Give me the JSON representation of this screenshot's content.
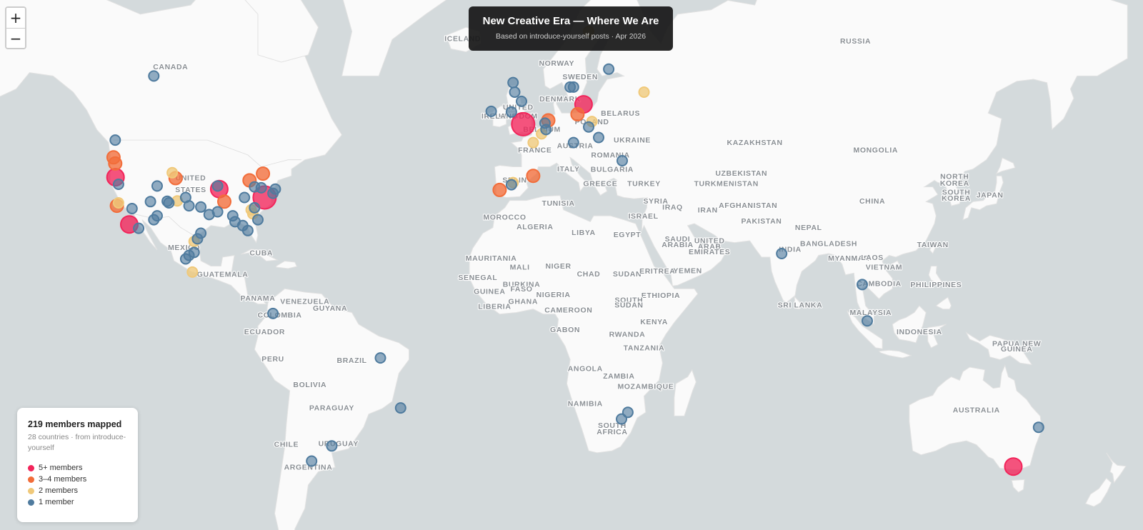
{
  "title": "New Creative Era — Where We Are",
  "subtitle": "Based on introduce-yourself posts · Apr 2026",
  "zoom": {
    "in_label": "+",
    "out_label": "−"
  },
  "legend": {
    "heading": "219 members mapped",
    "subtitle": "28 countries · from introduce-yourself",
    "items": [
      {
        "label": "5+ members",
        "color": "#f2245a"
      },
      {
        "label": "3–4 members",
        "color": "#f26d3a"
      },
      {
        "label": "2 members",
        "color": "#f0c97a"
      },
      {
        "label": "1 member",
        "color": "#4f7b9e"
      }
    ]
  },
  "colors": {
    "water": "#d4dadc",
    "land": "#fafafa"
  },
  "country_labels": [
    {
      "name": "CANADA",
      "lon": -106,
      "lat": 61
    },
    {
      "name": "UNITED",
      "lon": -100,
      "lat": 40.5
    },
    {
      "name": "STATES",
      "lon": -100,
      "lat": 37.8
    },
    {
      "name": "MEXICO",
      "lon": -102,
      "lat": 23
    },
    {
      "name": "CUBA",
      "lon": -79,
      "lat": 21.5
    },
    {
      "name": "GUATEMALA",
      "lon": -90.5,
      "lat": 15.4
    },
    {
      "name": "PANAMA",
      "lon": -80,
      "lat": 8.5
    },
    {
      "name": "VENEZUELA",
      "lon": -66,
      "lat": 7.5
    },
    {
      "name": "COLOMBIA",
      "lon": -73.5,
      "lat": 3.5
    },
    {
      "name": "GUYANA",
      "lon": -58.5,
      "lat": 5.5
    },
    {
      "name": "ECUADOR",
      "lon": -78,
      "lat": -1.5
    },
    {
      "name": "PERU",
      "lon": -75.5,
      "lat": -9.5
    },
    {
      "name": "BRAZIL",
      "lon": -52,
      "lat": -10
    },
    {
      "name": "BOLIVIA",
      "lon": -64.5,
      "lat": -17
    },
    {
      "name": "PARAGUAY",
      "lon": -58,
      "lat": -23.5
    },
    {
      "name": "CHILE",
      "lon": -71.5,
      "lat": -33
    },
    {
      "name": "ARGENTINA",
      "lon": -65,
      "lat": -38.5
    },
    {
      "name": "URUGUAY",
      "lon": -56,
      "lat": -32.8
    },
    {
      "name": "ICELAND",
      "lon": -19,
      "lat": 64.8
    },
    {
      "name": "NORWAY",
      "lon": 9,
      "lat": 61.5
    },
    {
      "name": "SWEDEN",
      "lon": 16,
      "lat": 59.5
    },
    {
      "name": "UNITED",
      "lon": -2.5,
      "lat": 54.6
    },
    {
      "name": "KINGDOM",
      "lon": -2.5,
      "lat": 53
    },
    {
      "name": "IRELAND",
      "lon": -8,
      "lat": 53
    },
    {
      "name": "DENMARK",
      "lon": 10,
      "lat": 56
    },
    {
      "name": "BELGIUM",
      "lon": 4.6,
      "lat": 50.6
    },
    {
      "name": "POLAND",
      "lon": 19.5,
      "lat": 52
    },
    {
      "name": "BELARUS",
      "lon": 28,
      "lat": 53.5
    },
    {
      "name": "UKRAINE",
      "lon": 31.5,
      "lat": 48.5
    },
    {
      "name": "FRANCE",
      "lon": 2.5,
      "lat": 46.5
    },
    {
      "name": "AUSTRIA",
      "lon": 14.5,
      "lat": 47.4
    },
    {
      "name": "ROMANIA",
      "lon": 25,
      "lat": 45.5
    },
    {
      "name": "SPAIN",
      "lon": -3.5,
      "lat": 40
    },
    {
      "name": "ITALY",
      "lon": 12.5,
      "lat": 42.5
    },
    {
      "name": "BULGARIA",
      "lon": 25.5,
      "lat": 42.4
    },
    {
      "name": "GREECE",
      "lon": 22,
      "lat": 39.2
    },
    {
      "name": "TURKEY",
      "lon": 35,
      "lat": 39.2
    },
    {
      "name": "RUSSIA",
      "lon": 98,
      "lat": 64.5
    },
    {
      "name": "KAZAKHSTAN",
      "lon": 68,
      "lat": 48
    },
    {
      "name": "MONGOLIA",
      "lon": 104,
      "lat": 46.5
    },
    {
      "name": "UZBEKISTAN",
      "lon": 64,
      "lat": 41.5
    },
    {
      "name": "TURKMENISTAN",
      "lon": 59.5,
      "lat": 39.2
    },
    {
      "name": "NORTH",
      "lon": 127.5,
      "lat": 40.8
    },
    {
      "name": "KOREA",
      "lon": 127.5,
      "lat": 39.3
    },
    {
      "name": "SOUTH",
      "lon": 128,
      "lat": 37.2
    },
    {
      "name": "KOREA",
      "lon": 128,
      "lat": 35.7
    },
    {
      "name": "JAPAN",
      "lon": 138,
      "lat": 36.5
    },
    {
      "name": "CHINA",
      "lon": 103,
      "lat": 35
    },
    {
      "name": "TUNISIA",
      "lon": 9.5,
      "lat": 34.5
    },
    {
      "name": "SYRIA",
      "lon": 38.5,
      "lat": 35
    },
    {
      "name": "IRAQ",
      "lon": 43.5,
      "lat": 33.5
    },
    {
      "name": "IRAN",
      "lon": 54,
      "lat": 32.8
    },
    {
      "name": "AFGHANISTAN",
      "lon": 66,
      "lat": 34
    },
    {
      "name": "ISRAEL",
      "lon": 34.8,
      "lat": 31.3
    },
    {
      "name": "PAKISTAN",
      "lon": 70,
      "lat": 30
    },
    {
      "name": "NEPAL",
      "lon": 84,
      "lat": 28.3
    },
    {
      "name": "MOROCCO",
      "lon": -6.5,
      "lat": 31
    },
    {
      "name": "ALGERIA",
      "lon": 2.5,
      "lat": 28.5
    },
    {
      "name": "LIBYA",
      "lon": 17,
      "lat": 27
    },
    {
      "name": "EGYPT",
      "lon": 30,
      "lat": 26.5
    },
    {
      "name": "SAUDI",
      "lon": 45,
      "lat": 25.3
    },
    {
      "name": "ARABIA",
      "lon": 45,
      "lat": 23.8
    },
    {
      "name": "UNITED",
      "lon": 54.5,
      "lat": 24.8
    },
    {
      "name": "ARAB",
      "lon": 54.5,
      "lat": 23.3
    },
    {
      "name": "EMIRATES",
      "lon": 54.5,
      "lat": 21.8
    },
    {
      "name": "BANGLADESH",
      "lon": 90,
      "lat": 24
    },
    {
      "name": "TAIWAN",
      "lon": 121,
      "lat": 23.8
    },
    {
      "name": "INDIA",
      "lon": 78.5,
      "lat": 22.5
    },
    {
      "name": "MYANMAR",
      "lon": 96,
      "lat": 20
    },
    {
      "name": "LAOS",
      "lon": 103,
      "lat": 20.2
    },
    {
      "name": "VIETNAM",
      "lon": 106.5,
      "lat": 17.5
    },
    {
      "name": "CAMBODIA",
      "lon": 105,
      "lat": 12.8
    },
    {
      "name": "PHILIPPINES",
      "lon": 122,
      "lat": 12.5
    },
    {
      "name": "MAURITANIA",
      "lon": -10.5,
      "lat": 20
    },
    {
      "name": "MALI",
      "lon": -2,
      "lat": 17.5
    },
    {
      "name": "NIGER",
      "lon": 9.5,
      "lat": 17.8
    },
    {
      "name": "CHAD",
      "lon": 18.5,
      "lat": 15.5
    },
    {
      "name": "SUDAN",
      "lon": 30,
      "lat": 15.5
    },
    {
      "name": "ERITREA",
      "lon": 39,
      "lat": 16.4
    },
    {
      "name": "YEMEN",
      "lon": 48,
      "lat": 16.5
    },
    {
      "name": "SENEGAL",
      "lon": -14.5,
      "lat": 14.5
    },
    {
      "name": "BURKINA",
      "lon": -1.5,
      "lat": 12.6
    },
    {
      "name": "FASO",
      "lon": -1.5,
      "lat": 11.2
    },
    {
      "name": "GUINEA",
      "lon": -11,
      "lat": 10.5
    },
    {
      "name": "NIGERIA",
      "lon": 8,
      "lat": 9.5
    },
    {
      "name": "ETHIOPIA",
      "lon": 40,
      "lat": 9.3
    },
    {
      "name": "GHANA",
      "lon": -1,
      "lat": 7.5
    },
    {
      "name": "LIBERIA",
      "lon": -9.5,
      "lat": 6.1
    },
    {
      "name": "SOUTH",
      "lon": 30.5,
      "lat": 8
    },
    {
      "name": "SUDAN",
      "lon": 30.5,
      "lat": 6.5
    },
    {
      "name": "CAMEROON",
      "lon": 12.5,
      "lat": 5
    },
    {
      "name": "SRI LANKA",
      "lon": 81.5,
      "lat": 6.5
    },
    {
      "name": "MALAYSIA",
      "lon": 102.5,
      "lat": 4.2
    },
    {
      "name": "KENYA",
      "lon": 38,
      "lat": 1.5
    },
    {
      "name": "GABON",
      "lon": 11.5,
      "lat": -0.8
    },
    {
      "name": "RWANDA",
      "lon": 30,
      "lat": -2.2
    },
    {
      "name": "INDONESIA",
      "lon": 117,
      "lat": -1.5
    },
    {
      "name": "TANZANIA",
      "lon": 35,
      "lat": -6.3
    },
    {
      "name": "PAPUA NEW",
      "lon": 146,
      "lat": -5
    },
    {
      "name": "GUINEA",
      "lon": 146,
      "lat": -6.6
    },
    {
      "name": "ANGOLA",
      "lon": 17.5,
      "lat": -12.3
    },
    {
      "name": "ZAMBIA",
      "lon": 27.5,
      "lat": -14.5
    },
    {
      "name": "MOZAMBIQUE",
      "lon": 35.5,
      "lat": -17.5
    },
    {
      "name": "NAMIBIA",
      "lon": 17.5,
      "lat": -22.3
    },
    {
      "name": "SOUTH",
      "lon": 25.5,
      "lat": -28.2
    },
    {
      "name": "AFRICA",
      "lon": 25.5,
      "lat": -29.8
    },
    {
      "name": "AUSTRALIA",
      "lon": 134,
      "lat": -24
    }
  ],
  "markers": [
    {
      "lon": -111,
      "lat": 60,
      "count": 1
    },
    {
      "lon": -122.5,
      "lat": 49,
      "count": 1
    },
    {
      "lon": -123,
      "lat": 45.5,
      "count": 3
    },
    {
      "lon": -122.5,
      "lat": 44.2,
      "count": 3
    },
    {
      "lon": -122.4,
      "lat": 41.2,
      "count": 5
    },
    {
      "lon": -121.5,
      "lat": 39.6,
      "count": 1
    },
    {
      "lon": -121.5,
      "lat": 35.2,
      "count": 2
    },
    {
      "lon": -122,
      "lat": 34.5,
      "count": 3
    },
    {
      "lon": -117.5,
      "lat": 33.8,
      "count": 1
    },
    {
      "lon": -118.3,
      "lat": 29.8,
      "count": 5
    },
    {
      "lon": -115.5,
      "lat": 28.8,
      "count": 1
    },
    {
      "lon": -111,
      "lat": 31,
      "count": 1
    },
    {
      "lon": -105.5,
      "lat": 42.2,
      "count": 2
    },
    {
      "lon": -104.5,
      "lat": 41,
      "count": 3
    },
    {
      "lon": -110,
      "lat": 39.2,
      "count": 1
    },
    {
      "lon": -112,
      "lat": 35.5,
      "count": 1
    },
    {
      "lon": -107,
      "lat": 35.6,
      "count": 1
    },
    {
      "lon": -106.5,
      "lat": 35.2,
      "count": 1
    },
    {
      "lon": -110,
      "lat": 32,
      "count": 1
    },
    {
      "lon": -104,
      "lat": 35.7,
      "count": 2
    },
    {
      "lon": -101.5,
      "lat": 36.5,
      "count": 1
    },
    {
      "lon": -100.5,
      "lat": 34.5,
      "count": 1
    },
    {
      "lon": -97,
      "lat": 34.2,
      "count": 1
    },
    {
      "lon": -94.5,
      "lat": 32.3,
      "count": 1
    },
    {
      "lon": -97,
      "lat": 27.5,
      "count": 1
    },
    {
      "lon": -98,
      "lat": 26,
      "count": 1
    },
    {
      "lon": -99,
      "lat": 25.3,
      "count": 2
    },
    {
      "lon": -100.5,
      "lat": 21.5,
      "count": 1
    },
    {
      "lon": -99,
      "lat": 22.3,
      "count": 1
    },
    {
      "lon": -101.5,
      "lat": 20.5,
      "count": 1
    },
    {
      "lon": -99.5,
      "lat": 16.8,
      "count": 2
    },
    {
      "lon": -92,
      "lat": 39.2,
      "count": 1
    },
    {
      "lon": -91.5,
      "lat": 38.5,
      "count": 5
    },
    {
      "lon": -90,
      "lat": 35.5,
      "count": 3
    },
    {
      "lon": -92,
      "lat": 33,
      "count": 1
    },
    {
      "lon": -87.5,
      "lat": 32,
      "count": 1
    },
    {
      "lon": -86.8,
      "lat": 30.5,
      "count": 1
    },
    {
      "lon": -84.5,
      "lat": 29.5,
      "count": 1
    },
    {
      "lon": -83,
      "lat": 28.2,
      "count": 1
    },
    {
      "lon": -84,
      "lat": 36.5,
      "count": 1
    },
    {
      "lon": -82.5,
      "lat": 40.5,
      "count": 4
    },
    {
      "lon": -81,
      "lat": 39,
      "count": 1
    },
    {
      "lon": -78.5,
      "lat": 42,
      "count": 3
    },
    {
      "lon": -79,
      "lat": 38.8,
      "count": 1
    },
    {
      "lon": -78,
      "lat": 36.5,
      "count": 6
    },
    {
      "lon": -75.5,
      "lat": 37.5,
      "count": 1
    },
    {
      "lon": -74.8,
      "lat": 38.5,
      "count": 1
    },
    {
      "lon": -81,
      "lat": 34,
      "count": 1
    },
    {
      "lon": -81.5,
      "lat": 32.5,
      "count": 2
    },
    {
      "lon": -82,
      "lat": 33.5,
      "count": 2
    },
    {
      "lon": -80,
      "lat": 31,
      "count": 1
    },
    {
      "lon": -75.5,
      "lat": 4.7,
      "count": 1
    },
    {
      "lon": -43.5,
      "lat": -8.5,
      "count": 1
    },
    {
      "lon": -37.5,
      "lat": -22.8,
      "count": 1
    },
    {
      "lon": -58,
      "lat": -32.8,
      "count": 1
    },
    {
      "lon": -64,
      "lat": -36.5,
      "count": 1
    },
    {
      "lon": -4,
      "lat": 59,
      "count": 1
    },
    {
      "lon": -3.5,
      "lat": 57.5,
      "count": 1
    },
    {
      "lon": -1.5,
      "lat": 56,
      "count": 1
    },
    {
      "lon": -10.5,
      "lat": 54.3,
      "count": 1
    },
    {
      "lon": -4.5,
      "lat": 54.2,
      "count": 1
    },
    {
      "lon": -1,
      "lat": 52,
      "count": 6
    },
    {
      "lon": 4.5,
      "lat": 50.2,
      "count": 2
    },
    {
      "lon": 5.5,
      "lat": 52.2,
      "count": 1
    },
    {
      "lon": 6.5,
      "lat": 52.7,
      "count": 3
    },
    {
      "lon": 5.8,
      "lat": 51,
      "count": 1
    },
    {
      "lon": 2,
      "lat": 48.5,
      "count": 2
    },
    {
      "lon": 13,
      "lat": 58.3,
      "count": 1
    },
    {
      "lon": 14,
      "lat": 58.3,
      "count": 1
    },
    {
      "lon": 15.2,
      "lat": 53.8,
      "count": 3
    },
    {
      "lon": 17,
      "lat": 55.5,
      "count": 5
    },
    {
      "lon": 19.5,
      "lat": 52.5,
      "count": 2
    },
    {
      "lon": 18.5,
      "lat": 51.5,
      "count": 1
    },
    {
      "lon": 21.5,
      "lat": 49.5,
      "count": 1
    },
    {
      "lon": 14,
      "lat": 48.5,
      "count": 1
    },
    {
      "lon": 24.5,
      "lat": 61,
      "count": 1
    },
    {
      "lon": 18.5,
      "lat": 66,
      "count": 2
    },
    {
      "lon": 35,
      "lat": 57.5,
      "count": 2
    },
    {
      "lon": 28.5,
      "lat": 44.8,
      "count": 1
    },
    {
      "lon": 2,
      "lat": 41.5,
      "count": 3
    },
    {
      "lon": -4,
      "lat": 40,
      "count": 2
    },
    {
      "lon": -4.5,
      "lat": 39.5,
      "count": 1
    },
    {
      "lon": -8,
      "lat": 38.3,
      "count": 3
    },
    {
      "lon": 28.3,
      "lat": -25.8,
      "count": 1
    },
    {
      "lon": 30.2,
      "lat": -24,
      "count": 1
    },
    {
      "lon": 76,
      "lat": 22,
      "count": 1
    },
    {
      "lon": 100,
      "lat": 13.2,
      "count": 1
    },
    {
      "lon": 101.5,
      "lat": 2.5,
      "count": 1
    },
    {
      "lon": 152.5,
      "lat": -28,
      "count": 1
    },
    {
      "lon": 145,
      "lat": -37.8,
      "count": 5
    }
  ]
}
